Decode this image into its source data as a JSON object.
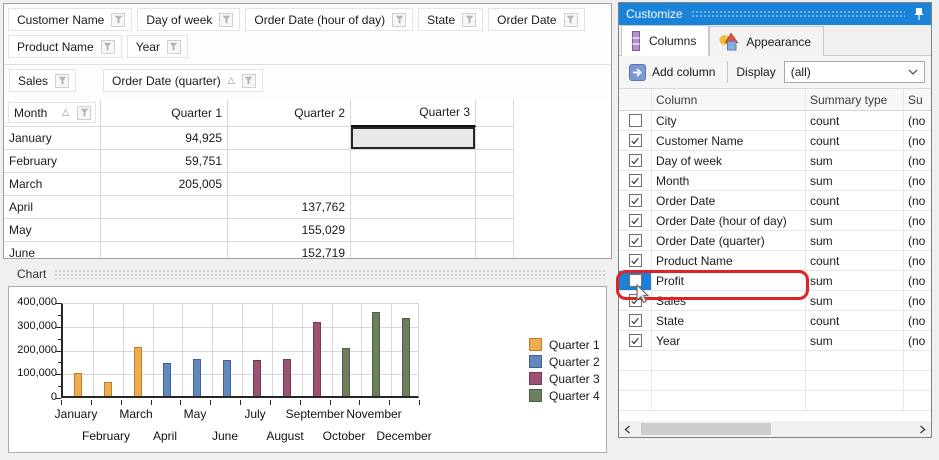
{
  "filter_fields": {
    "rows": [
      [
        "Customer Name",
        "Day of week",
        "Order Date (hour of day)",
        "State",
        "Order Date"
      ],
      [
        "Product Name",
        "Year"
      ]
    ]
  },
  "pivot": {
    "data_field": "Sales",
    "column_field": "Order Date (quarter)",
    "row_field": "Month",
    "column_headers": [
      "Quarter 1",
      "Quarter 2",
      "Quarter 3"
    ],
    "rows": [
      {
        "month": "January",
        "cells": [
          "94,925",
          "",
          ""
        ]
      },
      {
        "month": "February",
        "cells": [
          "59,751",
          "",
          ""
        ]
      },
      {
        "month": "March",
        "cells": [
          "205,005",
          "",
          ""
        ]
      },
      {
        "month": "April",
        "cells": [
          "",
          "137,762",
          ""
        ]
      },
      {
        "month": "May",
        "cells": [
          "",
          "155,029",
          ""
        ]
      },
      {
        "month": "June",
        "cells": [
          "",
          "152,719",
          ""
        ]
      }
    ],
    "selected_cell": {
      "row": 0,
      "col": 2
    }
  },
  "chart_section": {
    "caption": "Chart"
  },
  "chart_data": {
    "type": "bar",
    "title": "",
    "xlabel": "",
    "ylabel": "",
    "categories": [
      "January",
      "February",
      "March",
      "April",
      "May",
      "June",
      "July",
      "August",
      "September",
      "October",
      "November",
      "December"
    ],
    "series": [
      {
        "name": "Quarter 1",
        "color": "#F0AC4F",
        "border": "#B5812F",
        "values": [
          94925,
          59751,
          205005,
          null,
          null,
          null,
          null,
          null,
          null,
          null,
          null,
          null
        ]
      },
      {
        "name": "Quarter 2",
        "color": "#6288BD",
        "border": "#44618E",
        "values": [
          null,
          null,
          null,
          137762,
          155029,
          152719,
          null,
          null,
          null,
          null,
          null,
          null
        ]
      },
      {
        "name": "Quarter 3",
        "color": "#9B5273",
        "border": "#703A53",
        "values": [
          null,
          null,
          null,
          null,
          null,
          null,
          150000,
          157000,
          310000,
          null,
          null,
          null
        ]
      },
      {
        "name": "Quarter 4",
        "color": "#6C8060",
        "border": "#4D5C44",
        "values": [
          null,
          null,
          null,
          null,
          null,
          null,
          null,
          null,
          null,
          200000,
          355000,
          327000
        ]
      }
    ],
    "ylim": [
      0,
      400000
    ],
    "yticks": [
      0,
      100000,
      200000,
      300000,
      400000
    ],
    "ytick_labels": [
      "0",
      "100,000",
      "200,000",
      "300,000",
      "400,000"
    ],
    "grid": true,
    "legend_position": "right"
  },
  "customize": {
    "title": "Customize",
    "tabs": [
      {
        "label": "Columns"
      },
      {
        "label": "Appearance"
      }
    ],
    "active_tab": 0,
    "toolbar": {
      "add_button": "Add column",
      "display_label": "Display",
      "display_value": "(all)"
    },
    "grid": {
      "headers": {
        "check": "",
        "column": "Column",
        "summary": "Summary type",
        "extra": "Su"
      },
      "rows": [
        {
          "checked": false,
          "column": "City",
          "summary": "count",
          "extra": "(no"
        },
        {
          "checked": true,
          "column": "Customer Name",
          "summary": "count",
          "extra": "(no"
        },
        {
          "checked": true,
          "column": "Day of week",
          "summary": "sum",
          "extra": "(no"
        },
        {
          "checked": true,
          "column": "Month",
          "summary": "sum",
          "extra": "(no"
        },
        {
          "checked": true,
          "column": "Order Date",
          "summary": "count",
          "extra": "(no"
        },
        {
          "checked": true,
          "column": "Order Date (hour of day)",
          "summary": "sum",
          "extra": "(no"
        },
        {
          "checked": true,
          "column": "Order Date (quarter)",
          "summary": "sum",
          "extra": "(no"
        },
        {
          "checked": true,
          "column": "Product Name",
          "summary": "count",
          "extra": "(no"
        },
        {
          "checked": false,
          "column": "Profit",
          "summary": "sum",
          "extra": "(no",
          "selected": true,
          "annotated": true
        },
        {
          "checked": true,
          "column": "Sales",
          "summary": "sum",
          "extra": "(no"
        },
        {
          "checked": true,
          "column": "State",
          "summary": "count",
          "extra": "(no"
        },
        {
          "checked": true,
          "column": "Year",
          "summary": "sum",
          "extra": "(no"
        }
      ],
      "empty_rows": 3
    },
    "annotation_color": "#E02222"
  }
}
